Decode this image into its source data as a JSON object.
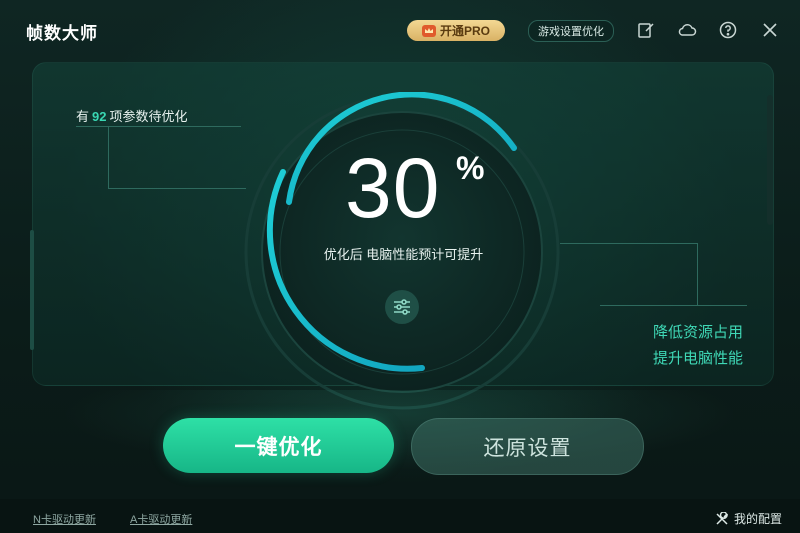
{
  "window": {
    "title": "帧数大师"
  },
  "header": {
    "pro_button_label": "开通PRO",
    "game_settings_button_label": "游戏设置优化"
  },
  "main": {
    "params_prefix": "有",
    "params_count": "92",
    "params_suffix": "项参数待优化",
    "gauge_value": "30",
    "gauge_unit": "%",
    "gauge_progress_fraction": 0.3,
    "gauge_subtitle": "优化后 电脑性能预计可提升",
    "benefit_line1": "降低资源占用",
    "benefit_line2": "提升电脑性能"
  },
  "actions": {
    "optimize_label": "一键优化",
    "restore_label": "还原设置"
  },
  "footer": {
    "nvidia_driver_link": "N卡驱动更新",
    "amd_driver_link": "A卡驱动更新",
    "my_config_label": "我的配置"
  },
  "colors": {
    "accent": "#2ee0a6",
    "gauge_arc": "#17b7c9",
    "pro_gold": "#e6c27b",
    "background": "#0c1d1a"
  },
  "icons": {
    "pro": "crown-icon",
    "edit": "edit-icon",
    "cloud": "cloud-icon",
    "help": "help-icon",
    "close": "close-icon",
    "settings": "sliders-icon",
    "config": "tools-icon"
  }
}
